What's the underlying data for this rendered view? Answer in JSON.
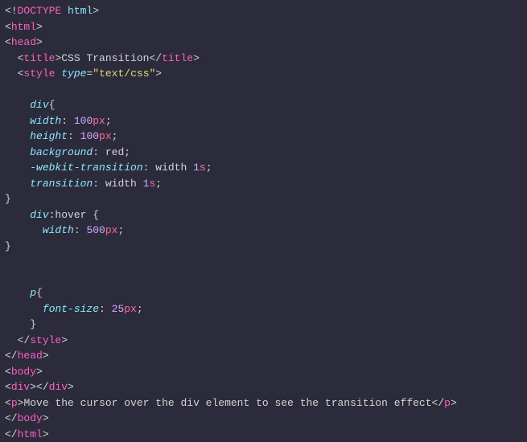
{
  "code": {
    "doctype_open": "<!",
    "doctype_kw": "DOCTYPE",
    "doctype_word": " html",
    "doctype_close": ">",
    "html_open": "html",
    "head_open": "head",
    "title_open": "title",
    "title_text": "CSS Transition",
    "title_close": "title",
    "style_open": "style",
    "style_attr_name": "type",
    "style_attr_eq": "=",
    "style_attr_val": "\"text/css\"",
    "sel_div": "div",
    "prop_width": "width",
    "val_100": "100",
    "unit_px": "px",
    "prop_height": "height",
    "prop_background": "background",
    "val_red": "red",
    "prop_webkit_transition": "-webkit-transition",
    "val_width_word": " width ",
    "val_1": "1",
    "unit_s": "s",
    "prop_transition": "transition",
    "sel_div_hover": "div",
    "pseudo_hover": ":hover ",
    "val_500": "500",
    "sel_p": "p",
    "prop_font_size": "font-size",
    "val_25": "25",
    "style_close": "style",
    "head_close": "head",
    "body_open": "body",
    "div_tag": "div",
    "p_tag": "p",
    "p_text": "Move the cursor over the div element to see the transition effect",
    "body_close": "body",
    "html_close": "html"
  }
}
